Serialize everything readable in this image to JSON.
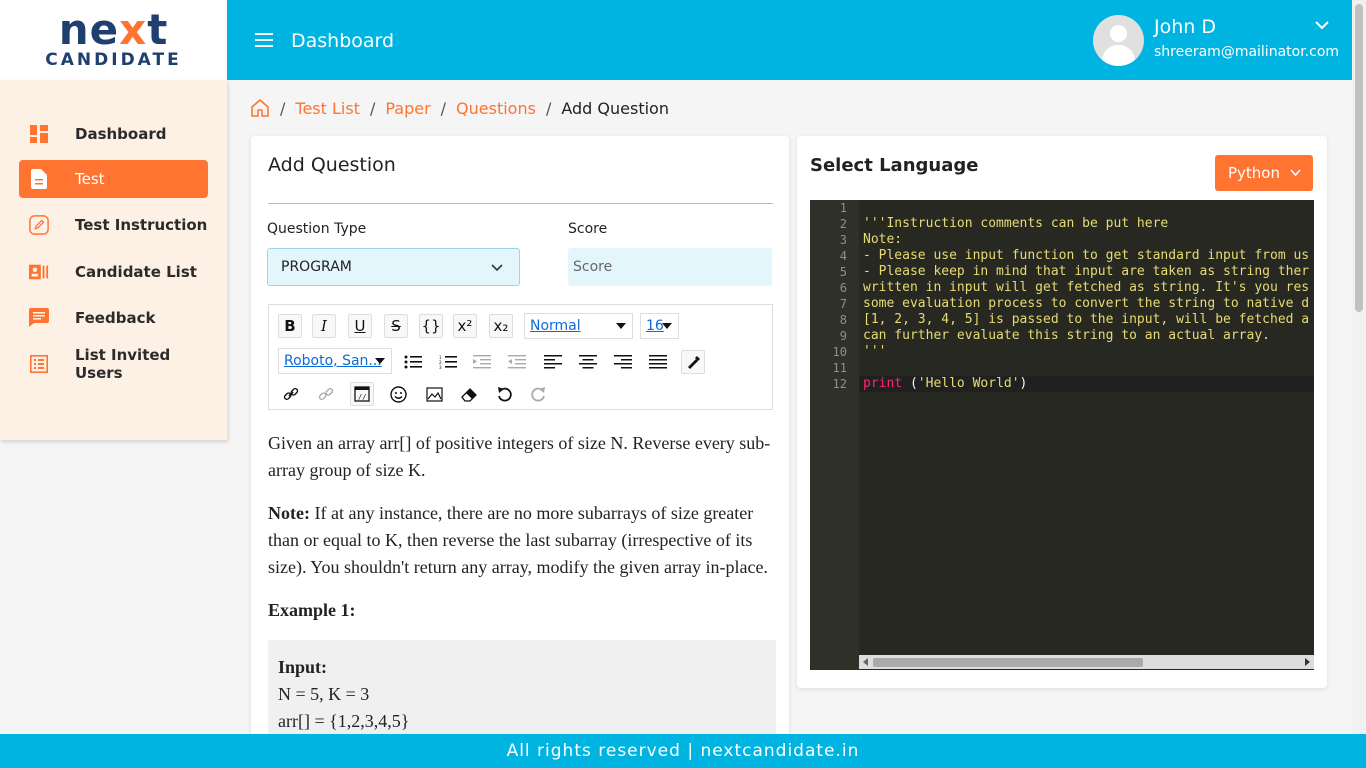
{
  "brand": {
    "logo_main_a": "ne",
    "logo_main_x": "x",
    "logo_main_b": "t",
    "logo_sub": "CANDIDATE"
  },
  "header": {
    "title": "Dashboard",
    "user_name": "John D",
    "user_email": "shreeram@mailinator.com"
  },
  "sidebar": {
    "items": [
      {
        "label": "Dashboard",
        "icon": "dashboard-icon",
        "active": false
      },
      {
        "label": "Test",
        "icon": "document-icon",
        "active": true
      },
      {
        "label": "Test Instruction",
        "icon": "edit-icon",
        "active": false
      },
      {
        "label": "Candidate List",
        "icon": "id-card-icon",
        "active": false
      },
      {
        "label": "Feedback",
        "icon": "feedback-icon",
        "active": false
      },
      {
        "label": "List Invited Users",
        "icon": "list-icon",
        "active": false
      }
    ]
  },
  "breadcrumb": {
    "items": [
      "Test List",
      "Paper",
      "Questions"
    ],
    "current": "Add Question",
    "sep": "/"
  },
  "form": {
    "title": "Add Question",
    "question_type_label": "Question Type",
    "question_type_value": "PROGRAM",
    "score_label": "Score",
    "score_placeholder": "Score"
  },
  "toolbar": {
    "bold": "B",
    "italic": "I",
    "underline": "U",
    "strike": "S",
    "code": "{}",
    "superscript": "x²",
    "subscript": "x₂",
    "format_value": "Normal",
    "size_value": "16",
    "font_value": "Roboto, San..."
  },
  "question": {
    "p1": "Given an array arr[] of positive integers of size N. Reverse every sub-array group of size K.",
    "note_label": "Note:",
    "p2": " If at any instance, there are no more subarrays of size greater than or equal to K, then reverse the last subarray (irrespective of its size). You shouldn't return any array, modify the given array in-place.",
    "example_label": "Example 1:",
    "input_label": "Input:",
    "input_line1": "N = 5, K = 3",
    "input_line2": "arr[] = {1,2,3,4,5}"
  },
  "language": {
    "title": "Select Language",
    "selected": "Python"
  },
  "editor": {
    "line_numbers": [
      "1",
      "2",
      "3",
      "4",
      "5",
      "6",
      "7",
      "8",
      "9",
      "10",
      "11",
      "12"
    ],
    "lines": [
      "",
      "'''Instruction comments can be put here",
      "Note:",
      "- Please use input function to get standard input from us",
      "- Please keep in mind that input are taken as string ther",
      "written in input will get fetched as string. It's you res",
      "some evaluation process to convert the string to native d",
      "[1, 2, 3, 4, 5] is passed to the input, will be fetched a",
      "can further evaluate this string to an actual array.",
      "'''",
      ""
    ],
    "last_kw": "print",
    "last_rest_a": " (",
    "last_str": "'Hello World'",
    "last_rest_b": ")"
  },
  "footer": {
    "text": "All rights reserved | nextcandidate.in"
  },
  "colors": {
    "primary": "#00b4e2",
    "accent": "#ff7431",
    "sidebar_bg": "#fdf1e5",
    "editor_bg": "#272822"
  }
}
